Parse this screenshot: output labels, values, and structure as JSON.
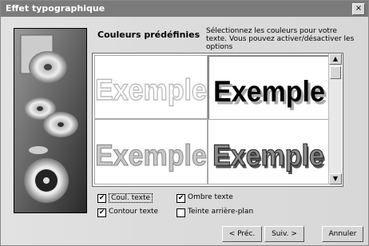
{
  "window": {
    "title": "Effet typographique",
    "close": "×"
  },
  "heading": "Couleurs prédéfinies",
  "instructions": "Sélectionnez les couleurs pour votre texte. Vous pouvez activer/désactiver les options",
  "samples": [
    "Exemple",
    "Exemple",
    "Exemple",
    "Exemple"
  ],
  "scroll": {
    "up": "▲",
    "down": "▼"
  },
  "options": [
    {
      "label": "Coul. texte",
      "checked": true
    },
    {
      "label": "Ombre texte",
      "checked": true
    },
    {
      "label": "Contour texte",
      "checked": true
    },
    {
      "label": "Teinte arrière-plan",
      "checked": false
    }
  ],
  "buttons": {
    "prev": "< Préc.",
    "next": "Suiv. >",
    "cancel": "Annuler"
  }
}
